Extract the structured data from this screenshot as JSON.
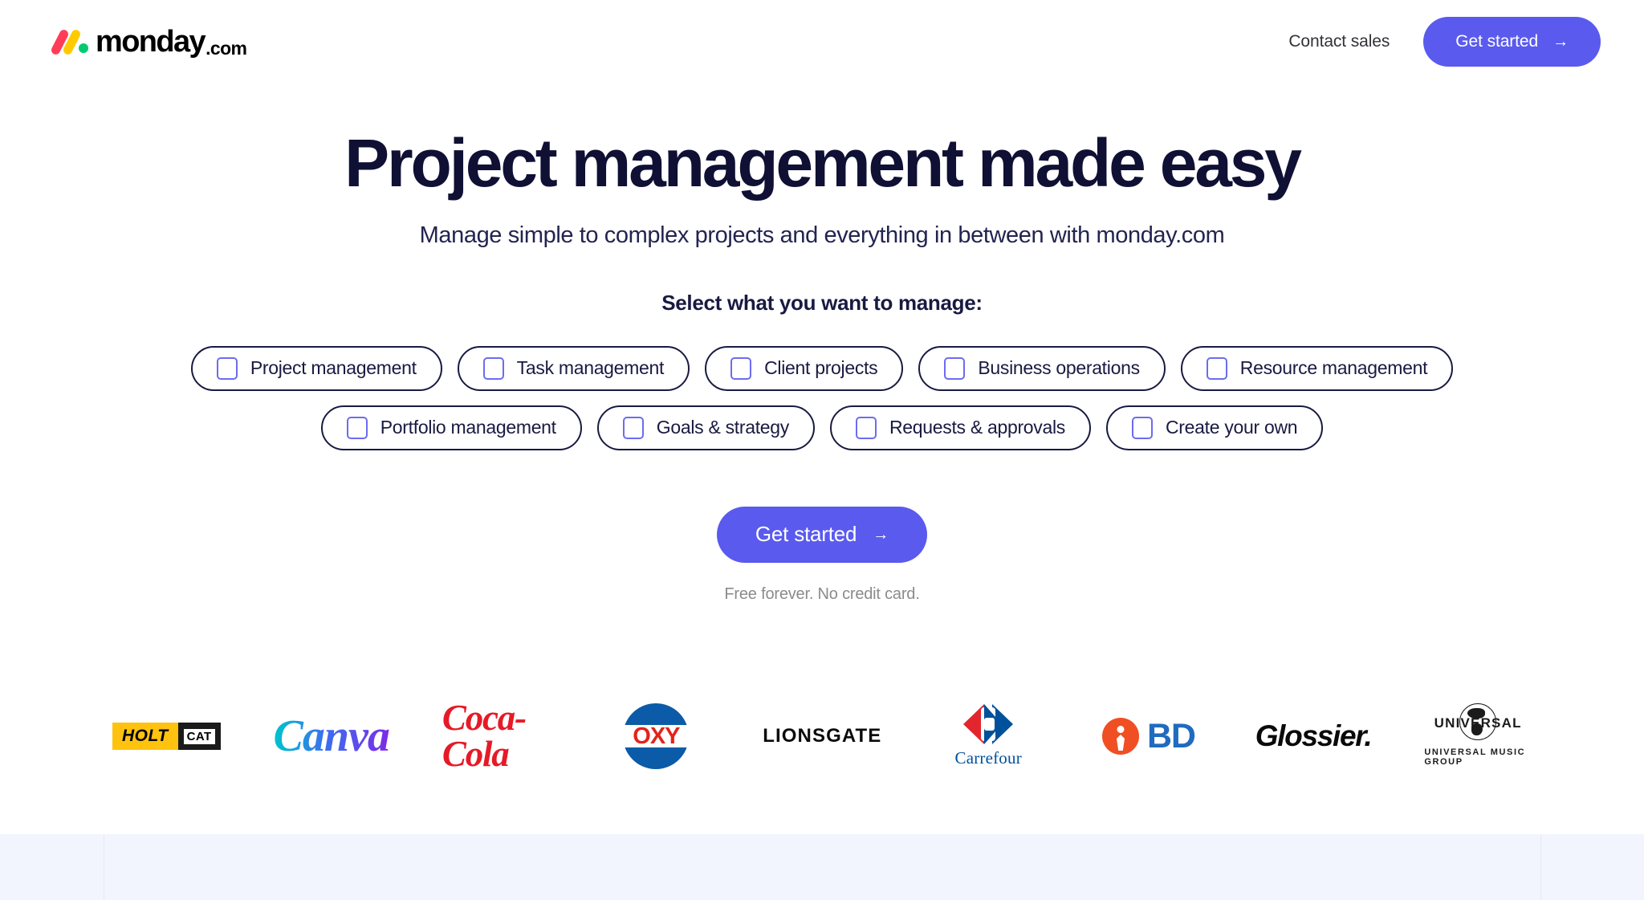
{
  "header": {
    "logo": {
      "name": "monday",
      "suffix": ".com",
      "colors": {
        "pink": "#ff3d57",
        "yellow": "#ffcb00",
        "green": "#00ca72"
      }
    },
    "contact_sales_label": "Contact sales",
    "get_started_label": "Get started",
    "arrow_icon": "→",
    "accent_color": "#5a5aef"
  },
  "hero": {
    "title": "Project management made easy",
    "subtitle": "Manage simple to complex projects and everything in between with monday.com",
    "select_label": "Select what you want to manage:"
  },
  "chips": {
    "row1": [
      {
        "label": "Project management",
        "checked": false
      },
      {
        "label": "Task management",
        "checked": false
      },
      {
        "label": "Client projects",
        "checked": false
      },
      {
        "label": "Business operations",
        "checked": false
      },
      {
        "label": "Resource management",
        "checked": false
      }
    ],
    "row2": [
      {
        "label": "Portfolio management",
        "checked": false
      },
      {
        "label": "Goals & strategy",
        "checked": false
      },
      {
        "label": "Requests & approvals",
        "checked": false
      },
      {
        "label": "Create your own",
        "checked": false
      }
    ],
    "checkbox_color": "#6c6cf0",
    "border_color": "#181a41"
  },
  "cta": {
    "label": "Get started",
    "arrow_icon": "→",
    "note": "Free forever. No credit card."
  },
  "clients": [
    {
      "name": "HOLT CAT",
      "word": "HOLT",
      "sub": "CAT"
    },
    {
      "name": "Canva",
      "word": "Canva"
    },
    {
      "name": "Coca-Cola",
      "word": "Coca-Cola"
    },
    {
      "name": "OXY",
      "word": "OXY"
    },
    {
      "name": "Lionsgate",
      "word": "LIONSGATE"
    },
    {
      "name": "Carrefour",
      "word": "Carrefour"
    },
    {
      "name": "BD",
      "word": "BD"
    },
    {
      "name": "Glossier",
      "word": "Glossier."
    },
    {
      "name": "Universal Music Group",
      "word": "UNIVERSAL",
      "sub": "UNIVERSAL MUSIC GROUP"
    }
  ]
}
